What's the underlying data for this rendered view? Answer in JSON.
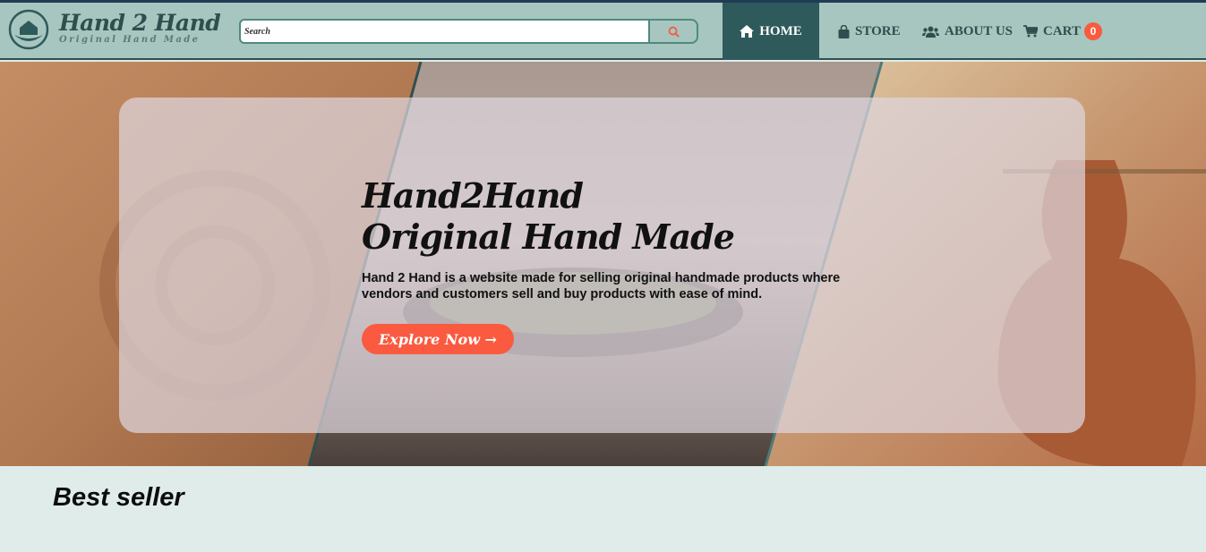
{
  "header": {
    "brand_name": "Hand 2 Hand",
    "brand_tagline": "Original Hand Made",
    "search_placeholder": "Search"
  },
  "nav": {
    "home": "HOME",
    "store": "STORE",
    "about": "ABOUT US",
    "cart": "CART",
    "cart_count": "0"
  },
  "hero": {
    "title_line1": "Hand2Hand",
    "title_line2": "Original Hand Made",
    "description": "Hand 2 Hand is a website made for selling original handmade products where vendors and customers sell and buy products with ease of mind.",
    "cta": "Explore Now →"
  },
  "sections": {
    "best_seller": "Best seller"
  },
  "colors": {
    "header_bg": "#a6c6bf",
    "active_nav": "#2f5a5b",
    "accent": "#fa5a40",
    "page_bg": "#dfecea"
  },
  "icons": [
    "hands-logo-icon",
    "search-icon",
    "home-icon",
    "bag-icon",
    "users-icon",
    "cart-icon"
  ]
}
